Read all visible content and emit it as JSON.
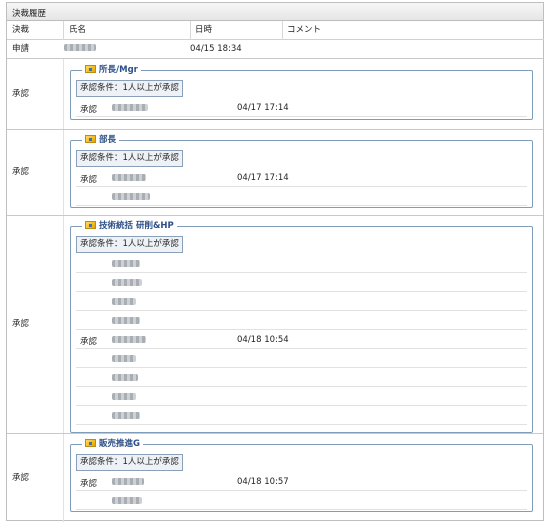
{
  "panel": {
    "title": "決裁履歴"
  },
  "columns": {
    "decision": "決裁",
    "name": "氏名",
    "datetime": "日時",
    "comment": "コメント"
  },
  "apply_row": {
    "kind": "申請",
    "datetime": "04/15 18:34"
  },
  "condition_text": "承認条件：1人以上が承認",
  "sections": [
    {
      "label": "承認",
      "group": "所長/Mgr",
      "rows": [
        {
          "kind": "承認",
          "datetime": "04/17 17:14"
        }
      ]
    },
    {
      "label": "承認",
      "group": "部長",
      "rows": [
        {
          "kind": "承認",
          "datetime": "04/17 17:14"
        },
        {
          "kind": "",
          "datetime": ""
        }
      ]
    },
    {
      "label": "承認",
      "group": "技術統括 研削&HP",
      "rows": [
        {
          "kind": "",
          "datetime": ""
        },
        {
          "kind": "",
          "datetime": ""
        },
        {
          "kind": "",
          "datetime": ""
        },
        {
          "kind": "",
          "datetime": ""
        },
        {
          "kind": "承認",
          "datetime": "04/18 10:54"
        },
        {
          "kind": "",
          "datetime": ""
        },
        {
          "kind": "",
          "datetime": ""
        },
        {
          "kind": "",
          "datetime": ""
        },
        {
          "kind": "",
          "datetime": ""
        }
      ]
    },
    {
      "label": "承認",
      "group": "販売推進G",
      "rows": [
        {
          "kind": "承認",
          "datetime": "04/18 10:57"
        },
        {
          "kind": "",
          "datetime": ""
        }
      ]
    }
  ]
}
